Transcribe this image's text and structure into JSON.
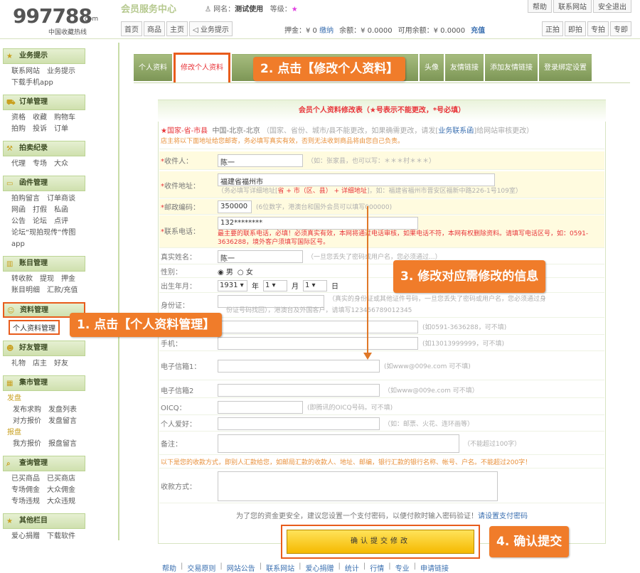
{
  "logo": {
    "big": "997788",
    "dot": ".com",
    "sub": "中国收藏热线"
  },
  "header": {
    "center_title": "会员服务中心",
    "user_label": "网名：",
    "user_name": "测试使用",
    "level_label": "等级：",
    "level_star": "★",
    "top_links": [
      "帮助",
      "联系网站",
      "安全退出"
    ],
    "nav": [
      "首页",
      "商品",
      "主页",
      "业务提示"
    ],
    "money": {
      "deposit_label": "押金：¥ 0",
      "deposit_link": "缴纳",
      "balance": "余额：¥ 0.0000",
      "available": "可用余额：¥ 0.0000",
      "recharge": "充值"
    },
    "nav_right": [
      "正拍",
      "即拍",
      "专拍",
      "专即"
    ]
  },
  "sidebar": {
    "sections": [
      {
        "title": "业务提示",
        "icon": "star-icon",
        "items": [
          "联系网站",
          "业务提示",
          "下载手机app"
        ]
      },
      {
        "title": "订单管理",
        "icon": "cart-icon",
        "items": [
          "资格",
          "收藏",
          "购物车",
          "拍购",
          "投诉",
          "订单"
        ]
      },
      {
        "title": "拍卖纪录",
        "icon": "gavel-icon",
        "items": [
          "代理",
          "专场",
          "大众"
        ]
      },
      {
        "title": "函件管理",
        "icon": "mail-icon",
        "items": [
          "拍购留言",
          "订单商谈",
          "网函",
          "打假",
          "私函",
          "公告",
          "论坛",
          "点评",
          "论坛“现拍现传”传图app"
        ]
      },
      {
        "title": "账目管理",
        "icon": "ledger-icon",
        "items": [
          "转收款",
          "提现",
          "押金",
          "账目明细",
          "汇款/充值"
        ]
      },
      {
        "title": "资料管理",
        "icon": "user-icon",
        "items": [
          "个人资料管理"
        ]
      },
      {
        "title": "好友管理",
        "icon": "friends-icon",
        "items": [
          "礼物",
          "店主",
          "好友"
        ]
      },
      {
        "title": "集市管理",
        "icon": "market-icon",
        "items": [
          "发盘",
          "发布求购",
          "发盘列表",
          "对方报价",
          "发盘留言",
          "报盘",
          "我方报价",
          "报盘留言"
        ]
      },
      {
        "title": "查询管理",
        "icon": "search-icon",
        "items": [
          "已买商品",
          "已买商店",
          "专场佣金",
          "大众佣金",
          "专场违规",
          "大众违规"
        ]
      },
      {
        "title": "其他栏目",
        "icon": "star-icon",
        "items": [
          "爱心捐赠",
          "下载软件"
        ]
      }
    ]
  },
  "tabs": [
    "个人资料",
    "修改个人资料",
    "头像",
    "友情链接",
    "添加友情链接",
    "登录绑定设置"
  ],
  "form": {
    "title_a": "会员个人资料修改表（",
    "title_b": "★",
    "title_c": "号表示不能更改，",
    "title_d": "*",
    "title_e": "号必填）",
    "region_label": "★国家-省-市县",
    "region_value": "中国-北京-北京",
    "region_hint_a": "（国家、省份、城市/县不能更改，如果确需更改，请发[",
    "region_hint_link": "业务联系函",
    "region_hint_b": "]给网站审核更改）",
    "region_note": "店主将以下面地址给您邮寄，务必填写真实有效，否则无法收到商品将由您自己负责。",
    "receiver_label": "收件人：",
    "receiver_value": "陈一",
    "receiver_hint": "（如：张家县，也可以写：＊＊＊村＊＊＊）",
    "address_label": "收件地址：",
    "address_value": "福建省福州市",
    "address_hint_a": "（务必填写详细地址[",
    "address_hint_b": "省 + 市（区、县） + 详细地址",
    "address_hint_c": "]，如：福建省福州市晋安区福新中路226-1号109室）",
    "zip_label": "邮政编码：",
    "zip_value": "350000",
    "zip_hint": "(6位数字，港澳台和国外会员可以填写000000)",
    "phone_label": "联系电话：",
    "phone_value": "132********",
    "phone_note": "最主要的联系电话，必填！必须真实有效，本网将通过电话审核，如果电话不符，本网有权删除资料。请填写电话区号，如：0591-3636288，境外客户须填写国际区号。",
    "realname_label": "真实姓名：",
    "realname_value": "陈一",
    "realname_hint": "（一旦您丢失了密码或用户名，您必须通过...）",
    "gender_label": "性别：",
    "male": "男",
    "female": "女",
    "birth_label": "出生年月：",
    "year": "1931",
    "year_unit": "年",
    "month": "1",
    "month_unit": "月",
    "day": "1",
    "day_unit": "日",
    "id_label": "身份证：",
    "id_hint_a": "（真实的身份证或其他证件号码，一旦您丢失了密码或用户名，您必须通过身",
    "id_hint_b": "份证号码找回），港澳台及外国客户，请填写123456789012345",
    "tel_hint": "(如0591-3636288，可不填)",
    "mobile_label": "手机：",
    "mobile_hint": "(如13013999999，可不填)",
    "email1_label": "电子信箱1：",
    "email1_hint": "(如www@009e.com 可不填)",
    "email2_label": "电子信箱2",
    "email2_hint": "（如www@009e.com 可不填）",
    "oicq_label": "OICQ：",
    "oicq_hint": "(即腾讯的OICQ号码。可不填)",
    "hobby_label": "个人爱好：",
    "hobby_hint": "（如：邮票、火花、连环画等）",
    "remark_label": "备注：",
    "remark_hint": "（不能超过100字）",
    "pay_note": "以下是您的收款方式，即别人汇款给您，如邮局汇款的收款人、地址、邮编，银行汇款的银行名称、帐号、户名。不能超过200字！",
    "pay_label": "收款方式：",
    "safety_a": "为了您的资金更安全，建议您设置一个支付密码，以便付款时输入密码验证！",
    "safety_link": "请设置支付密码",
    "submit": "确认提交修改"
  },
  "callouts": {
    "c1": "1. 点击【个人资料管理】",
    "c2": "2. 点击【修改个人资料】",
    "c3": "3. 修改对应需修改的信息",
    "c4": "4. 确认提交"
  },
  "footer": [
    "帮助",
    "交易原则",
    "网站公告",
    "联系网站",
    "爱心捐赠",
    "统计",
    "行情",
    "专业",
    "申请链接"
  ],
  "colors": {
    "accent": "#f07c2a",
    "green": "#7d9656",
    "red": "#e8353a",
    "link": "#3a6fb0"
  }
}
